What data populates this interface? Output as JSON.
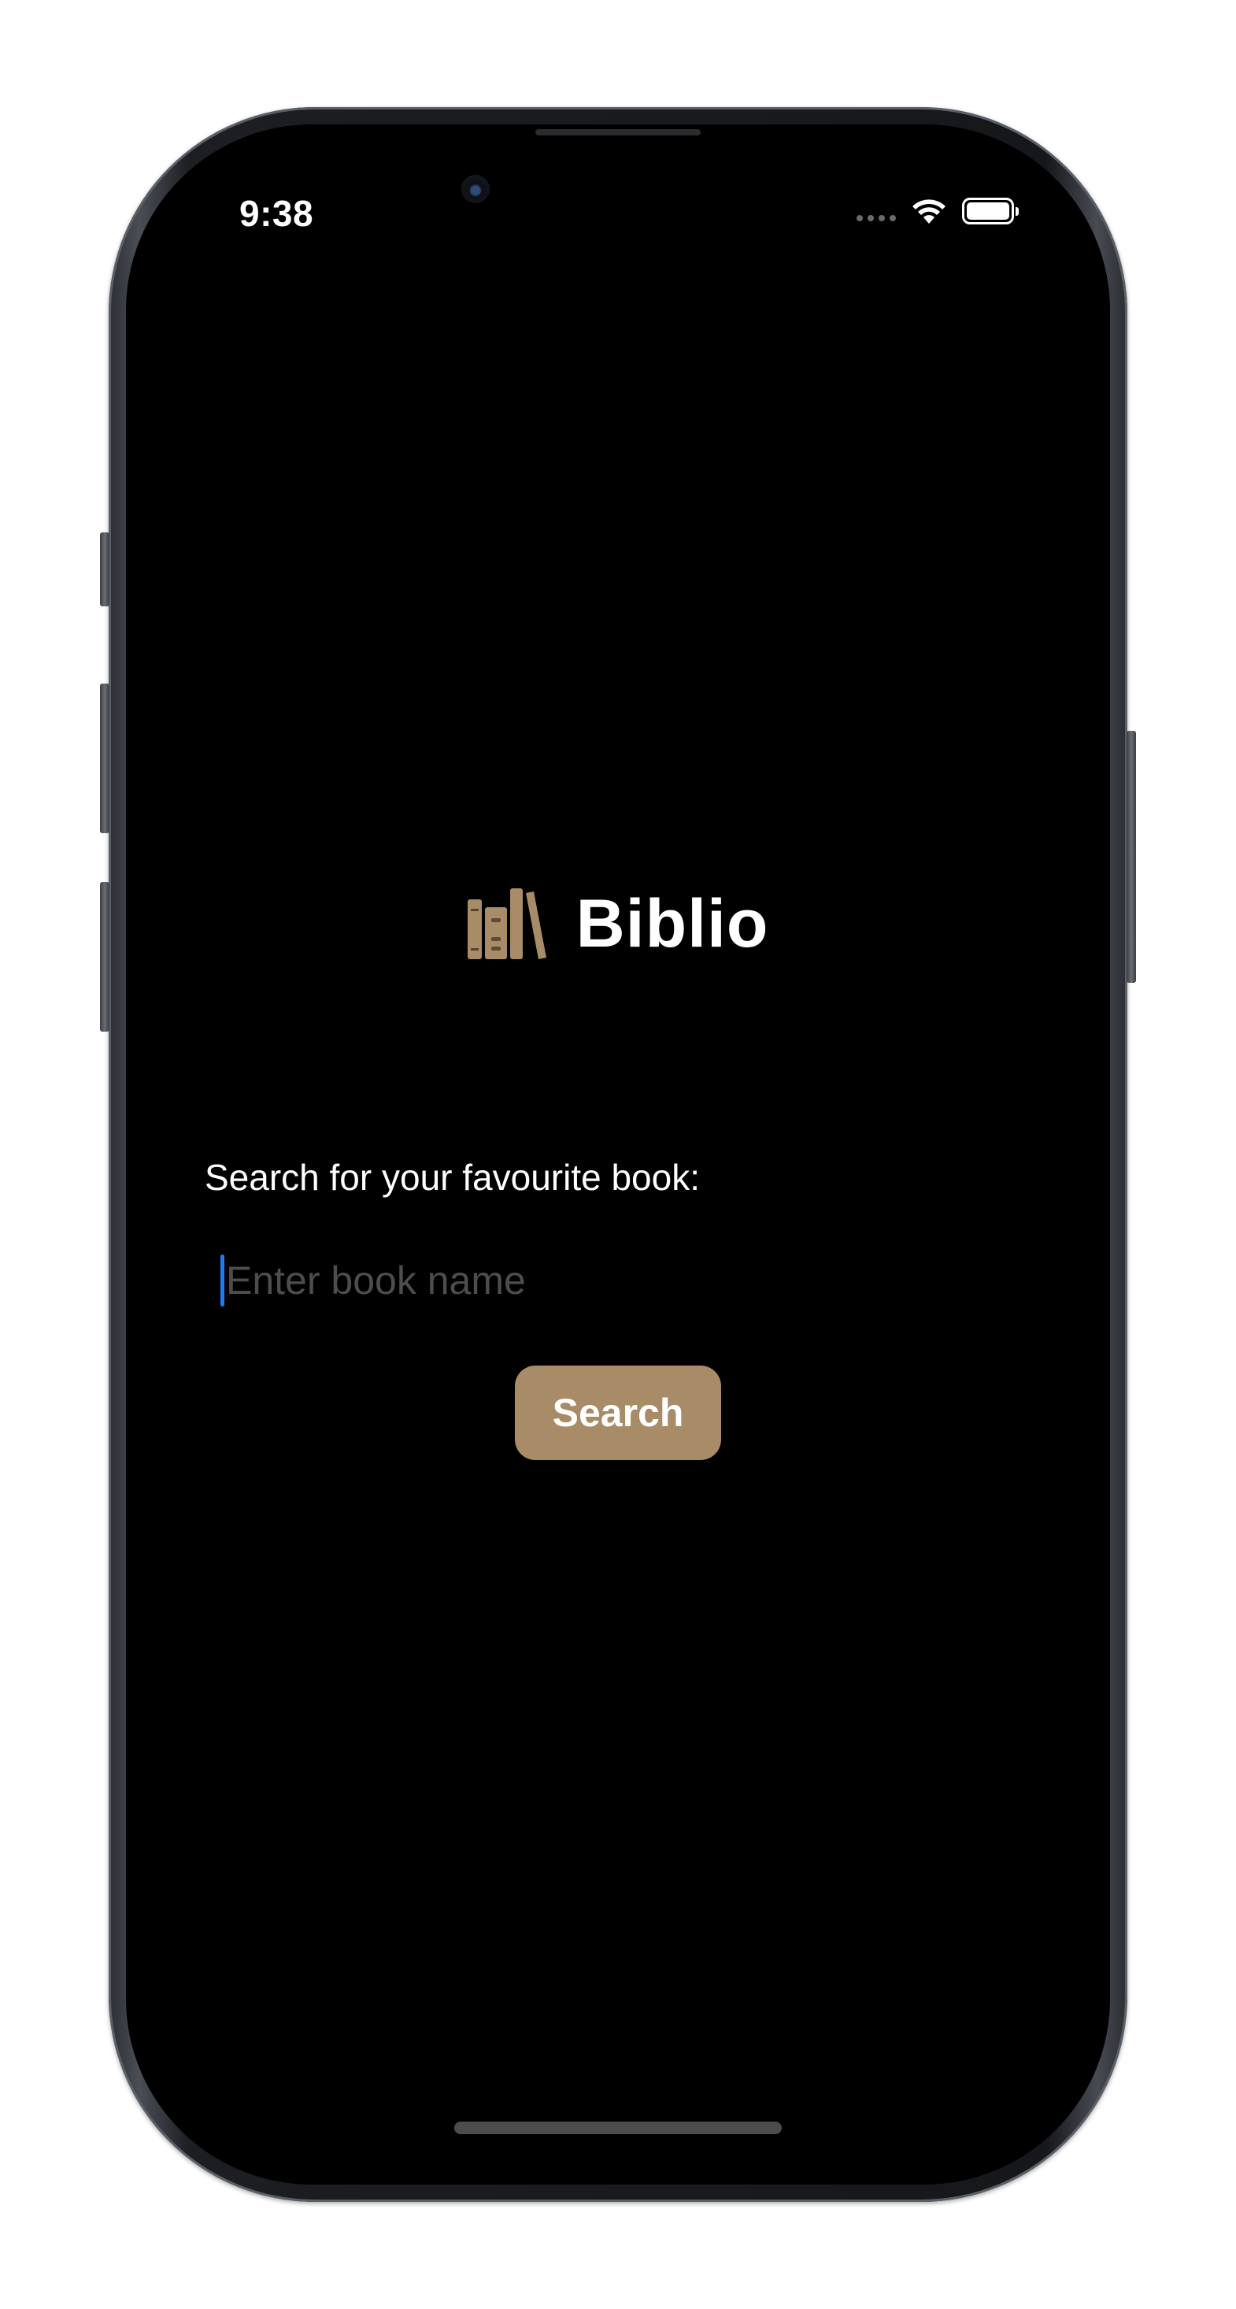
{
  "status_bar": {
    "time": "9:38"
  },
  "app": {
    "title": "Biblio",
    "logo_icon": "books-icon",
    "accent_color": "#A88B67"
  },
  "search": {
    "label": "Search for your favourite book:",
    "placeholder": "Enter book name",
    "value": "",
    "button_label": "Search"
  }
}
